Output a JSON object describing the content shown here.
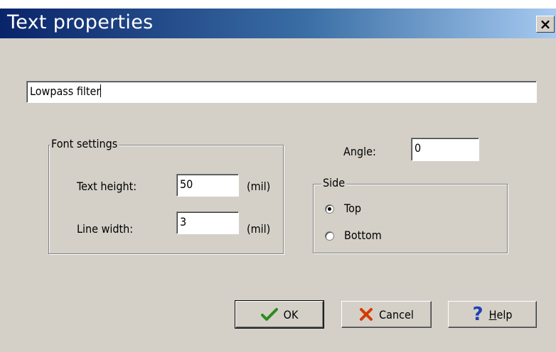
{
  "window": {
    "title": "Text properties",
    "close_glyph": "×"
  },
  "text_field": {
    "value": "Lowpass filter"
  },
  "font_settings": {
    "legend": "Font settings",
    "text_height": {
      "label": "Text height:",
      "value": "50",
      "unit": "(mil)"
    },
    "line_width": {
      "label": "Line width:",
      "value": "3",
      "unit": "(mil)"
    }
  },
  "angle": {
    "label": "Angle:",
    "value": "0"
  },
  "side": {
    "legend": "Side",
    "options": [
      {
        "label": "Top",
        "selected": true
      },
      {
        "label": "Bottom",
        "selected": false
      }
    ]
  },
  "buttons": {
    "ok": {
      "label": "OK",
      "icon": "checkmark-icon"
    },
    "cancel": {
      "label": "Cancel",
      "icon": "x-icon"
    },
    "help": {
      "label_underlined": "H",
      "label_rest": "elp",
      "icon": "question-icon"
    }
  },
  "colors": {
    "ok_icon": "#2e8b1f",
    "cancel_icon": "#d63a00",
    "help_icon": "#1f3fb5"
  }
}
